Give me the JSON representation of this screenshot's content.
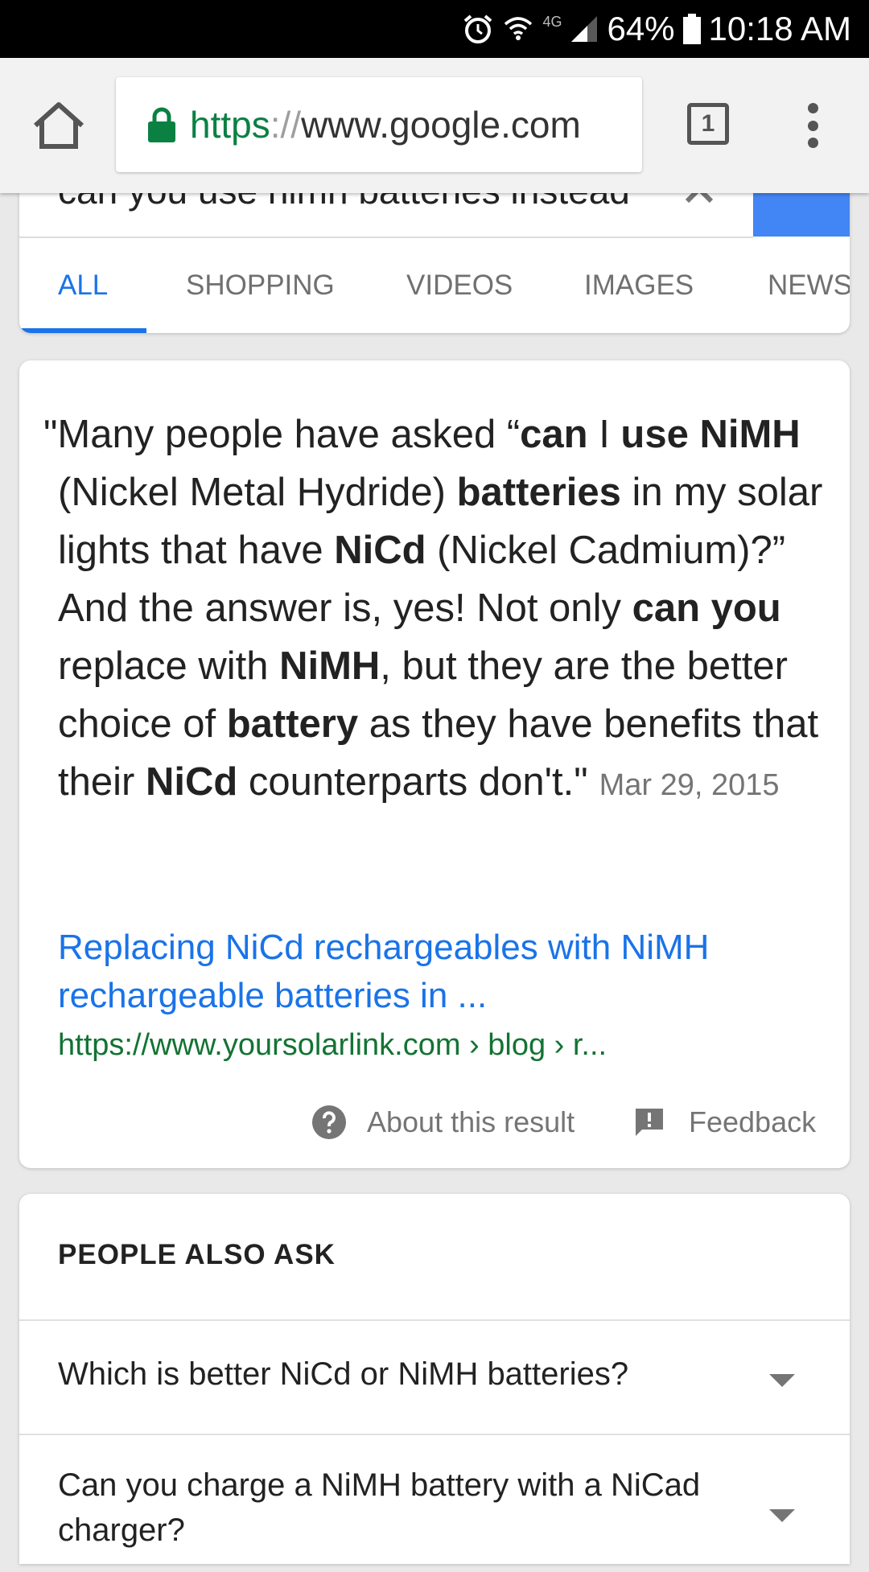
{
  "status_bar": {
    "network_label": "4G",
    "battery_percent": "64%",
    "time": "10:18 AM",
    "icons": [
      "alarm-icon",
      "wifi-icon",
      "signal-icon",
      "battery-icon"
    ]
  },
  "browser": {
    "url_scheme": "https",
    "url_separator": "://",
    "url_host": "www.google.com",
    "tab_count": "1",
    "icons": [
      "home-icon",
      "lock-icon",
      "tabs-icon",
      "more-vert-icon"
    ]
  },
  "search": {
    "query": "can you use nimh batteries instead",
    "tabs": [
      {
        "label": "ALL",
        "active": true
      },
      {
        "label": "SHOPPING",
        "active": false
      },
      {
        "label": "VIDEOS",
        "active": false
      },
      {
        "label": "IMAGES",
        "active": false
      },
      {
        "label": "NEWS",
        "active": false
      }
    ],
    "accent_color": "#4285f4"
  },
  "featured_snippet": {
    "segments": [
      {
        "text": "\"Many people have asked “",
        "bold": false
      },
      {
        "text": "can",
        "bold": true
      },
      {
        "text": " I ",
        "bold": false
      },
      {
        "text": "use",
        "bold": true
      },
      {
        "text": " ",
        "bold": false
      },
      {
        "text": "NiMH",
        "bold": true
      },
      {
        "text": " (Nickel Metal Hydride) ",
        "bold": false
      },
      {
        "text": "batteries",
        "bold": true
      },
      {
        "text": " in my solar lights that have ",
        "bold": false
      },
      {
        "text": "NiCd",
        "bold": true
      },
      {
        "text": " (Nickel Cadmium)?” And the answer is, yes! Not only ",
        "bold": false
      },
      {
        "text": "can you",
        "bold": true
      },
      {
        "text": " replace with ",
        "bold": false
      },
      {
        "text": "NiMH",
        "bold": true
      },
      {
        "text": ", but they are the better choice of ",
        "bold": false
      },
      {
        "text": "battery",
        "bold": true
      },
      {
        "text": " as they have benefits that their ",
        "bold": false
      },
      {
        "text": "NiCd",
        "bold": true
      },
      {
        "text": " counterparts don't.\"",
        "bold": false
      }
    ],
    "date": "Mar 29, 2015",
    "title": "Replacing NiCd rechargeables with NiMH rechargeable batteries in ...",
    "url": "https://www.yoursolarlink.com › blog › r...",
    "about_label": "About this result",
    "feedback_label": "Feedback"
  },
  "people_also_ask": {
    "title": "PEOPLE ALSO ASK",
    "questions": [
      "Which is better NiCd or NiMH batteries?",
      "Can you charge a NiMH battery with a NiCad charger?"
    ]
  }
}
